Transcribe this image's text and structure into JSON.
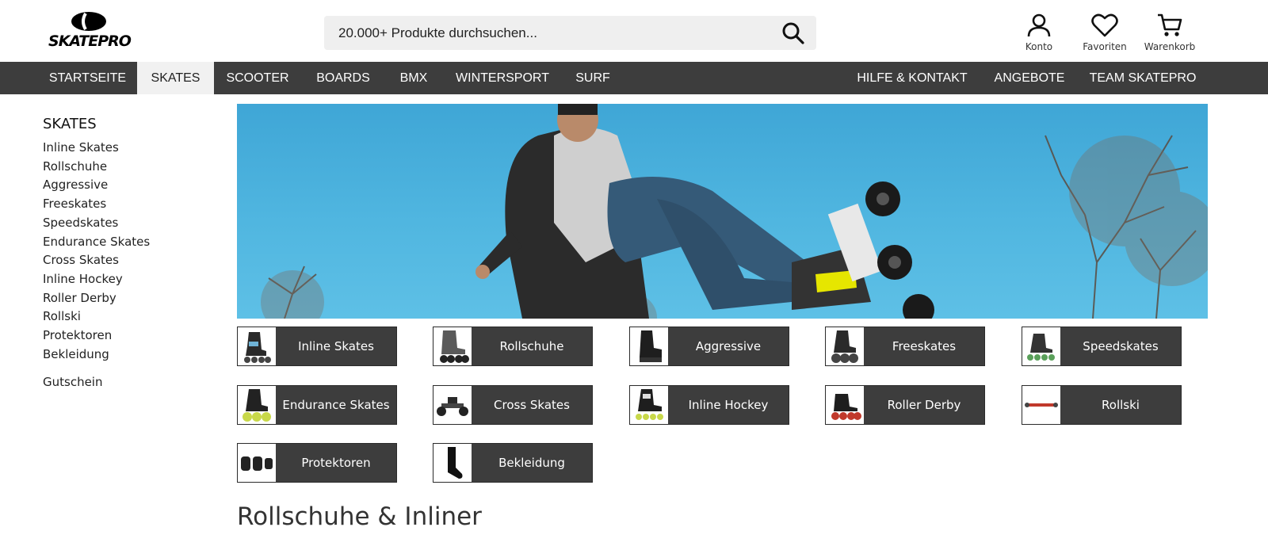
{
  "brand": {
    "name": "SKATEPRO"
  },
  "search": {
    "placeholder": "20.000+ Produkte durchsuchen..."
  },
  "header_icons": [
    {
      "label": "Konto",
      "icon": "user-icon"
    },
    {
      "label": "Favoriten",
      "icon": "heart-icon"
    },
    {
      "label": "Warenkorb",
      "icon": "cart-icon"
    }
  ],
  "nav": {
    "left": [
      "STARTSEITE",
      "SKATES",
      "SCOOTER",
      "BOARDS",
      "BMX",
      "WINTERSPORT",
      "SURF"
    ],
    "right": [
      "HILFE & KONTAKT",
      "ANGEBOTE",
      "TEAM SKATEPRO"
    ],
    "active": "SKATES"
  },
  "sidebar": {
    "title": "SKATES",
    "items": [
      "Inline Skates",
      "Rollschuhe",
      "Aggressive",
      "Freeskates",
      "Speedskates",
      "Endurance Skates",
      "Cross Skates",
      "Inline Hockey",
      "Roller Derby",
      "Rollski",
      "Protektoren",
      "Bekleidung"
    ],
    "voucher": "Gutschein"
  },
  "categories": [
    {
      "label": "Inline Skates",
      "icon": "inline-skate-icon"
    },
    {
      "label": "Rollschuhe",
      "icon": "roller-skate-icon"
    },
    {
      "label": "Aggressive",
      "icon": "aggressive-skate-icon"
    },
    {
      "label": "Freeskates",
      "icon": "freeskate-icon"
    },
    {
      "label": "Speedskates",
      "icon": "speedskate-icon"
    },
    {
      "label": "Endurance Skates",
      "icon": "endurance-skate-icon"
    },
    {
      "label": "Cross Skates",
      "icon": "cross-skate-icon"
    },
    {
      "label": "Inline Hockey",
      "icon": "hockey-skate-icon"
    },
    {
      "label": "Roller Derby",
      "icon": "derby-skate-icon"
    },
    {
      "label": "Rollski",
      "icon": "rollski-icon"
    },
    {
      "label": "Protektoren",
      "icon": "protector-icon"
    },
    {
      "label": "Bekleidung",
      "icon": "sock-icon"
    }
  ],
  "page": {
    "heading": "Rollschuhe & Inliner"
  },
  "colors": {
    "nav_bg": "#3d3d3d",
    "tile_bg": "#3d3d3d",
    "search_bg": "#efefef"
  }
}
